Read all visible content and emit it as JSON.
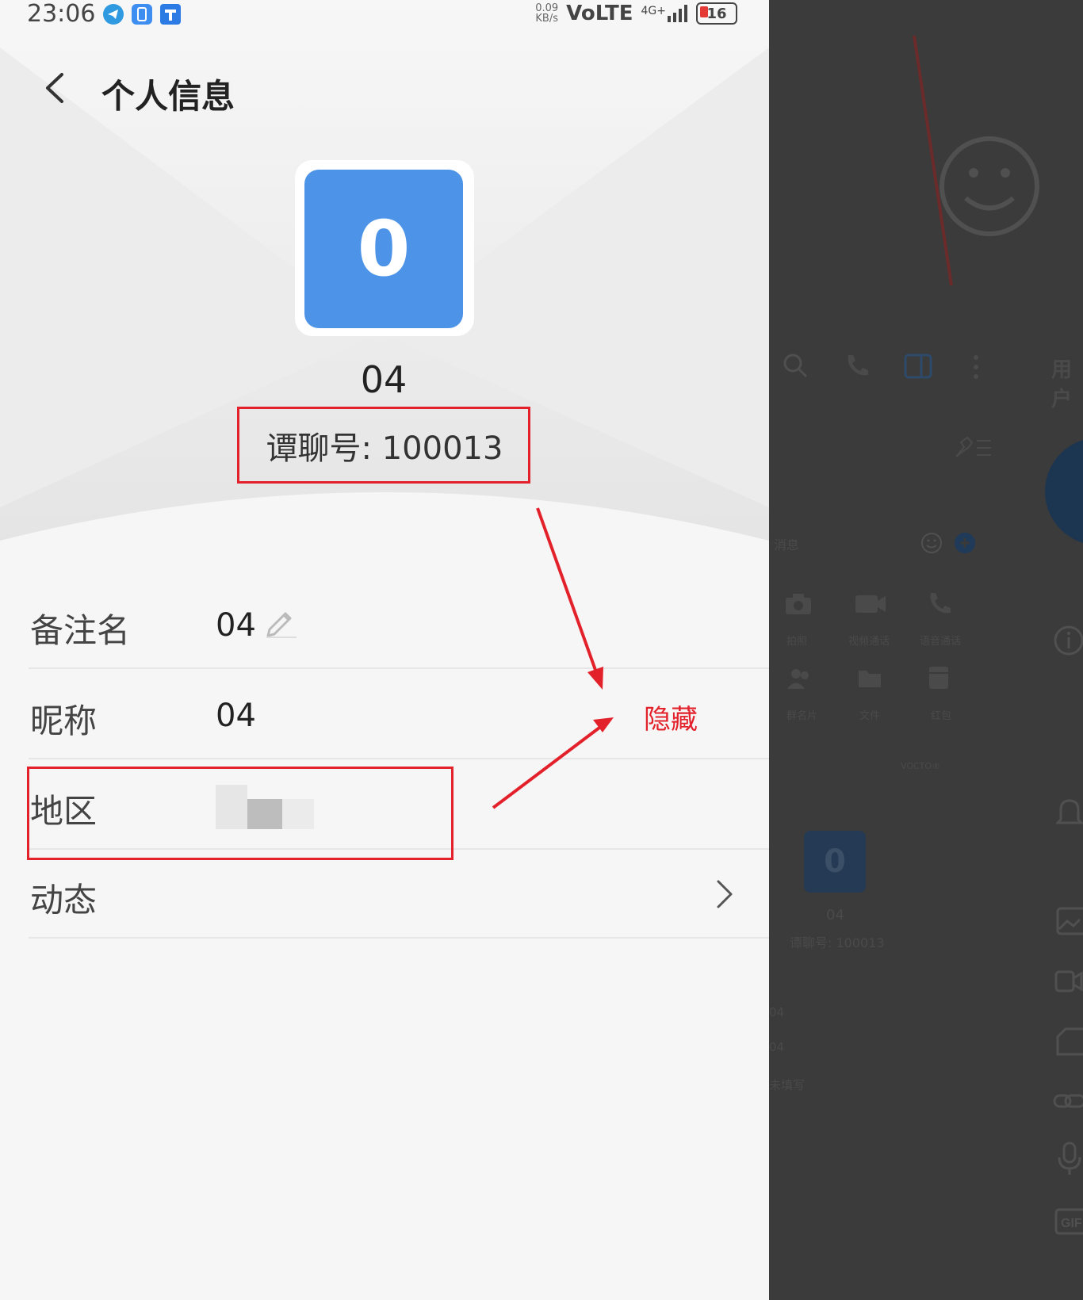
{
  "status_bar": {
    "time": "23:06",
    "net_speed_value": "0.09",
    "net_speed_unit": "KB/s",
    "network": "VoLTE",
    "network_type": "4G+",
    "battery": "16"
  },
  "header": {
    "title": "个人信息"
  },
  "profile": {
    "avatar_letter": "0",
    "display_name": "04",
    "id_text": "谭聊号: 100013"
  },
  "info_rows": [
    {
      "label": "备注名",
      "value": "04"
    },
    {
      "label": "昵称",
      "value": "04"
    },
    {
      "label": "地区",
      "value": ""
    },
    {
      "label": "动态",
      "value": ""
    }
  ],
  "annotation": {
    "label": "隐藏",
    "color": "#e3212b"
  },
  "background_window": {
    "header_label": "用户",
    "attach_items": [
      "拍照",
      "视频通话",
      "语音通话",
      "群名片",
      "文件",
      "红包"
    ],
    "input_placeholder": "消息",
    "watermark": "VOCTO®",
    "mini_profile": {
      "avatar_letter": "0",
      "name": "04",
      "id_text": "谭聊号: 100013"
    },
    "mini_rows": [
      "04",
      "04",
      "未填写"
    ]
  }
}
